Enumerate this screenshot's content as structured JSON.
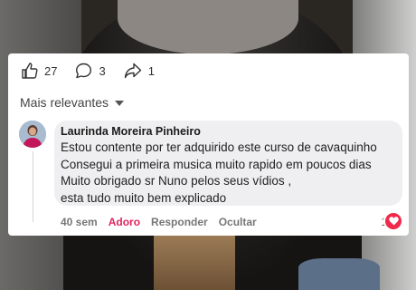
{
  "reactions": {
    "likes": "27",
    "comments": "3",
    "shares": "1"
  },
  "sort": {
    "label": "Mais relevantes"
  },
  "comment": {
    "author": "Laurinda Moreira Pinheiro",
    "text": "Estou contente por ter adquirido este curso de cavaquinho\nConsegui a primeira musica muito rapido em poucos dias\nMuito obrigado sr Nuno pelos seus vídios ,\nesta tudo muito bem explicado",
    "time": "40 sem",
    "reaction_label": "Adoro",
    "reply_label": "Responder",
    "hide_label": "Ocultar",
    "reaction_count": "1",
    "reaction_color": "#e0245e"
  },
  "icons": {
    "like": "thumbs-up-icon",
    "comment": "comment-bubble-icon",
    "share": "share-arrow-icon",
    "heart": "heart-icon"
  }
}
